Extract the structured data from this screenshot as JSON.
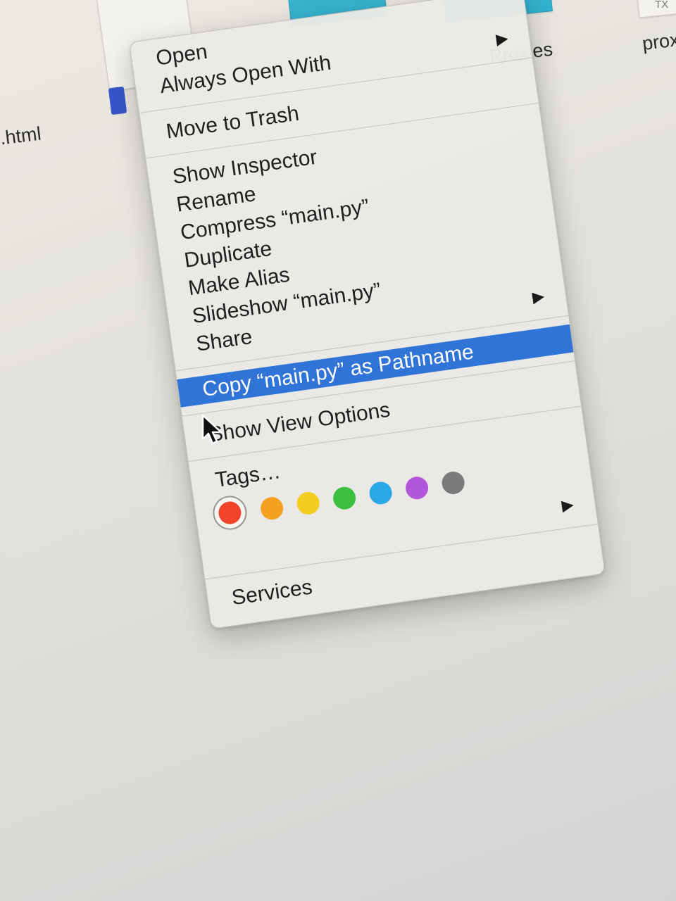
{
  "background": {
    "files": [
      {
        "name": "Proxies"
      },
      {
        "name": "prox"
      },
      {
        "name": ".html"
      }
    ],
    "thumb_tag": "TX"
  },
  "context_menu": {
    "groups": [
      [
        {
          "label": "Open",
          "has_submenu": false
        },
        {
          "label": "Always Open With",
          "has_submenu": true
        }
      ],
      [
        {
          "label": "Move to Trash",
          "has_submenu": false
        }
      ],
      [
        {
          "label": "Show Inspector",
          "has_submenu": false
        },
        {
          "label": "Rename",
          "has_submenu": false
        },
        {
          "label": "Compress “main.py”",
          "has_submenu": false
        },
        {
          "label": "Duplicate",
          "has_submenu": false
        },
        {
          "label": "Make Alias",
          "has_submenu": false
        },
        {
          "label": "Slideshow “main.py”",
          "has_submenu": false
        },
        {
          "label": "Share",
          "has_submenu": true
        }
      ],
      [
        {
          "label": "Copy “main.py” as Pathname",
          "has_submenu": false,
          "highlighted": true
        }
      ],
      [
        {
          "label": "Show View Options",
          "has_submenu": false
        }
      ]
    ],
    "tags": {
      "label": "Tags…",
      "colors": [
        {
          "name": "red",
          "hex": "#f2442a",
          "selected": true
        },
        {
          "name": "orange",
          "hex": "#f4a122"
        },
        {
          "name": "yellow",
          "hex": "#f3cd1f"
        },
        {
          "name": "green",
          "hex": "#3bbf3e"
        },
        {
          "name": "blue",
          "hex": "#2aa9e6"
        },
        {
          "name": "purple",
          "hex": "#b257d9"
        },
        {
          "name": "gray",
          "hex": "#7a7a7a"
        }
      ]
    },
    "services": {
      "label": "Services",
      "has_submenu": true
    },
    "highlight_color": "#2f74d6"
  }
}
